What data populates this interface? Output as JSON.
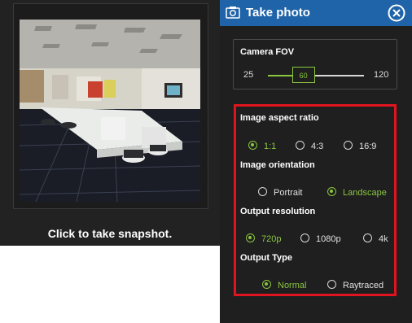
{
  "preview": {
    "snapshot_label": "Click to take snapshot."
  },
  "dialog": {
    "title": "Take photo"
  },
  "fov": {
    "title": "Camera FOV",
    "min": "25",
    "max": "120",
    "value": "60",
    "fraction": 0.37
  },
  "aspect": {
    "title": "Image aspect ratio",
    "options": [
      "1:1",
      "4:3",
      "16:9"
    ],
    "selected": "1:1"
  },
  "orientation": {
    "title": "Image orientation",
    "options": [
      "Portrait",
      "Landscape"
    ],
    "selected": "Landscape"
  },
  "resolution": {
    "title": "Output resolution",
    "options": [
      "720p",
      "1080p",
      "4k"
    ],
    "selected": "720p"
  },
  "output_type": {
    "title": "Output Type",
    "options": [
      "Normal",
      "Raytraced"
    ],
    "selected": "Normal"
  },
  "colors": {
    "accent": "#8bc63f",
    "title_bar": "#1f63a9",
    "highlight": "#e0141e"
  }
}
